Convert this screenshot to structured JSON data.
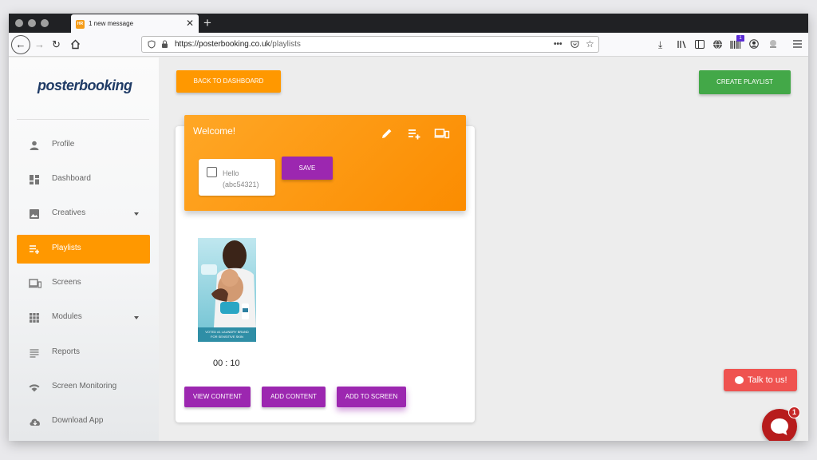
{
  "browser": {
    "tab_title": "1 new message",
    "tab_favicon": "HR",
    "url_host": "https://posterbooking.co.uk",
    "url_path": "/playlists",
    "toolbar_badge": "1"
  },
  "sidebar": {
    "logo": "posterbooking",
    "items": [
      {
        "label": "Profile",
        "icon": "person-icon"
      },
      {
        "label": "Dashboard",
        "icon": "dashboard-icon"
      },
      {
        "label": "Creatives",
        "icon": "image-icon"
      },
      {
        "label": "Playlists",
        "icon": "playlist-add-icon"
      },
      {
        "label": "Screens",
        "icon": "devices-icon"
      },
      {
        "label": "Modules",
        "icon": "grid-icon"
      },
      {
        "label": "Reports",
        "icon": "list-icon"
      },
      {
        "label": "Screen Monitoring",
        "icon": "wifi-icon"
      },
      {
        "label": "Download App",
        "icon": "cloud-download-icon"
      }
    ],
    "active": "Playlists"
  },
  "main": {
    "back_button": "BACK TO DASHBOARD",
    "create_button": "CREATE PLAYLIST",
    "playlist": {
      "title": "Welcome!",
      "item_name": "Hello",
      "item_code": "(abc54321)",
      "save_button": "SAVE",
      "poster_tagline_1": "VOTED #1 LAUNDRY BRAND",
      "poster_tagline_2": "FOR SENSITIVE SKIN",
      "duration": "00 : 10",
      "view_button": "VIEW CONTENT",
      "add_button": "ADD CONTENT",
      "screen_button": "ADD TO SCREEN"
    }
  },
  "chat": {
    "bubble_text": "Talk to us!",
    "badge": "1"
  },
  "colors": {
    "accent": "#ff9800",
    "success": "#43a848",
    "primary": "#9c27b0",
    "chat": "#ef5350"
  }
}
